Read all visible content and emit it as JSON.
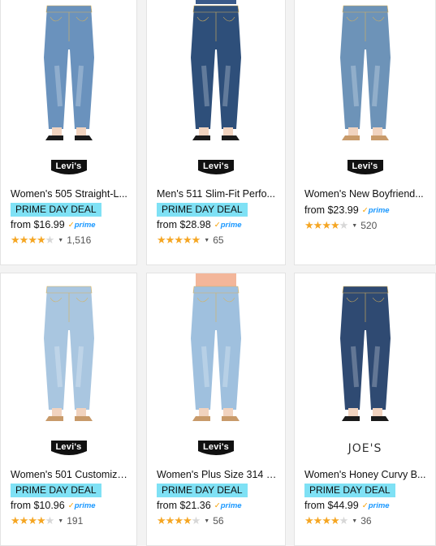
{
  "products": [
    {
      "brand": "Levi's",
      "title": "Women's 505 Straight-L...",
      "badge": "PRIME DAY DEAL",
      "price": "from $16.99",
      "prime": "prime",
      "rating": 4,
      "reviews": "1,516",
      "denim_color": "#6a92bd"
    },
    {
      "brand": "Levi's",
      "title": "Men's 511 Slim-Fit Perfo...",
      "badge": "PRIME DAY DEAL",
      "price": "from $28.98",
      "prime": "prime",
      "rating": 4.5,
      "reviews": "65",
      "denim_color": "#2e4f7a"
    },
    {
      "brand": "Levi's",
      "title": "Women's New Boyfriend...",
      "badge": "",
      "price": "from $23.99",
      "prime": "prime",
      "rating": 4,
      "reviews": "520",
      "denim_color": "#6d93b8"
    },
    {
      "brand": "Levi's",
      "title": "Women's 501 Customize...",
      "badge": "PRIME DAY DEAL",
      "price": "from $10.96",
      "prime": "prime",
      "rating": 4,
      "reviews": "191",
      "denim_color": "#a9c6e0"
    },
    {
      "brand": "Levi's",
      "title": "Women's Plus Size 314 S...",
      "badge": "PRIME DAY DEAL",
      "price": "from $21.36",
      "prime": "prime",
      "rating": 4,
      "reviews": "56",
      "denim_color": "#9fc0de"
    },
    {
      "brand": "JOE'S",
      "title": "Women's Honey Curvy B...",
      "badge": "PRIME DAY DEAL",
      "price": "from $44.99",
      "prime": "prime",
      "rating": 4,
      "reviews": "36",
      "denim_color": "#2f4a72"
    }
  ]
}
